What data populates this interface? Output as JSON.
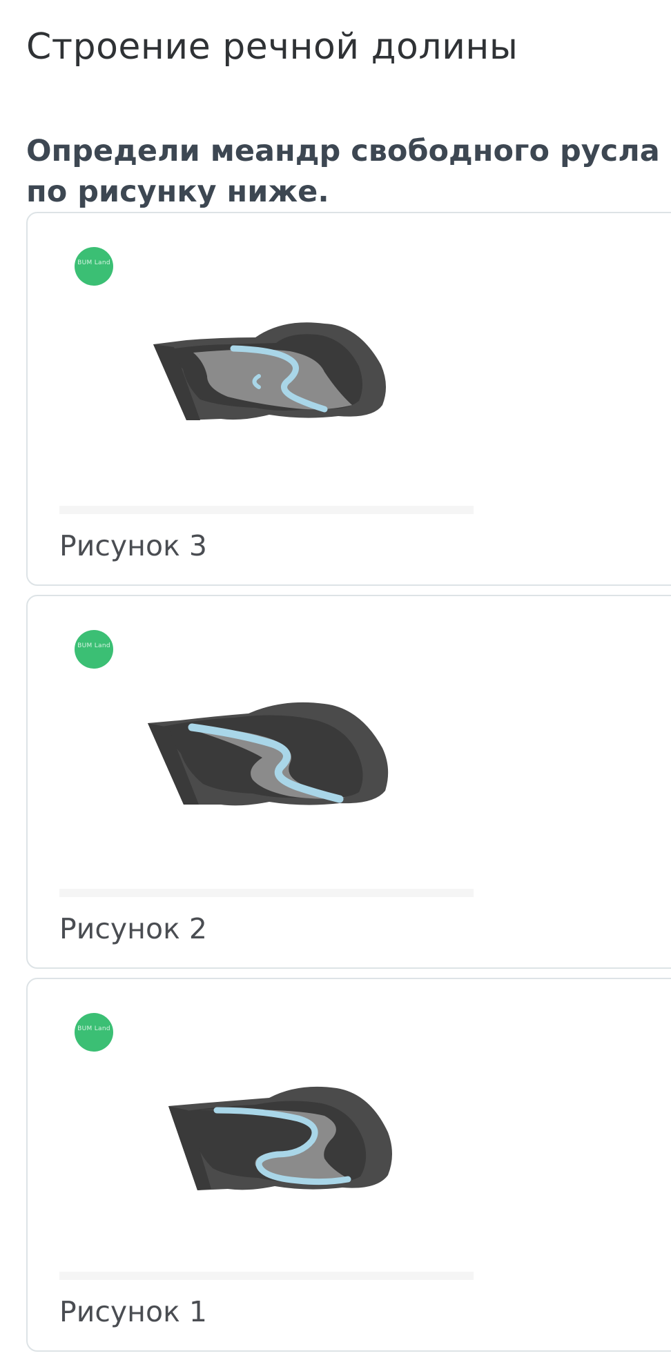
{
  "page": {
    "title": "Строение речной долины"
  },
  "question": {
    "text": "Определи меандр свободного русла по рисунку ниже."
  },
  "logo": {
    "text": "BUM Land"
  },
  "colors": {
    "river": "#a9d6e8",
    "floodplain": "#8b8b8b",
    "rock_dark": "#3a3a3a",
    "rock_mid": "#4b4b4b",
    "logo_green": "#3bbf74"
  },
  "options": [
    {
      "caption": "Рисунок 3",
      "variant": "oxbow"
    },
    {
      "caption": "Рисунок 2",
      "variant": "incised"
    },
    {
      "caption": "Рисунок 1",
      "variant": "free"
    }
  ]
}
